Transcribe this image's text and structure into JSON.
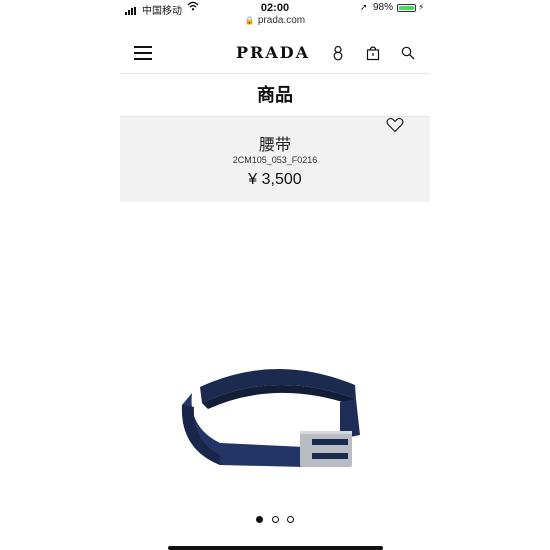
{
  "status_bar": {
    "carrier": "中国移动",
    "time": "02:00",
    "battery_percent": "98%",
    "battery_level": 0.98,
    "url": "prada.com"
  },
  "header": {
    "brand": "PRADA",
    "icons": [
      "menu-icon",
      "user-icon",
      "bag-icon",
      "search-icon"
    ]
  },
  "section": {
    "title": "商品"
  },
  "product": {
    "name": "腰带",
    "code": "2CM105_053_F0216",
    "price": "¥ 3,500"
  },
  "gallery": {
    "current_image": 1,
    "total_images": 3
  },
  "colors": {
    "belt": "#1e2c52",
    "card_bg": "#f2f2f2",
    "battery": "#4cd964"
  }
}
